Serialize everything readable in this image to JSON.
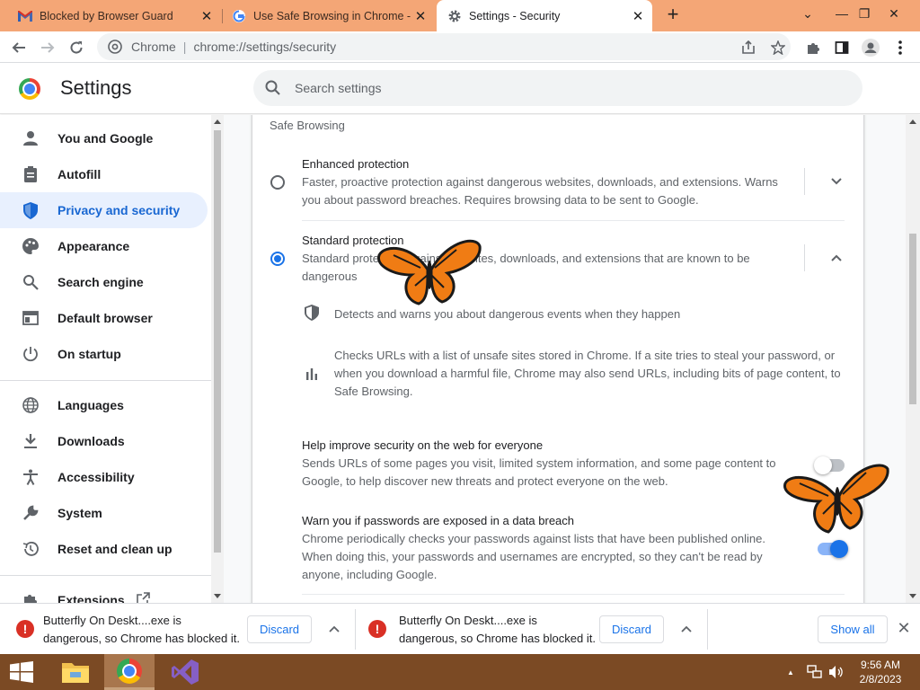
{
  "browser": {
    "tabs": [
      {
        "title": "Blocked by Browser Guard",
        "close": "✕",
        "icon": "gmail-icon"
      },
      {
        "title": "Use Safe Browsing in Chrome - C",
        "close": "✕",
        "icon": "google-icon"
      },
      {
        "title": "Settings - Security",
        "close": "✕",
        "icon": "gear-icon"
      }
    ],
    "new_tab": "+",
    "window_controls": {
      "menu": "⌄",
      "minimize": "—",
      "restore": "❐",
      "close": "✕"
    },
    "omnibox": {
      "site": "Chrome",
      "separator": "|",
      "url": "chrome://settings/security"
    }
  },
  "settings": {
    "title": "Settings",
    "search_placeholder": "Search settings",
    "sidebar": {
      "group1": [
        {
          "label": "You and Google",
          "icon": "person-icon"
        },
        {
          "label": "Autofill",
          "icon": "clipboard-icon"
        },
        {
          "label": "Privacy and security",
          "icon": "shield-icon",
          "active": true
        },
        {
          "label": "Appearance",
          "icon": "palette-icon"
        },
        {
          "label": "Search engine",
          "icon": "search-icon"
        },
        {
          "label": "Default browser",
          "icon": "browser-icon"
        },
        {
          "label": "On startup",
          "icon": "power-icon"
        }
      ],
      "group2": [
        {
          "label": "Languages",
          "icon": "globe-icon"
        },
        {
          "label": "Downloads",
          "icon": "download-icon"
        },
        {
          "label": "Accessibility",
          "icon": "accessibility-icon"
        },
        {
          "label": "System",
          "icon": "wrench-icon"
        },
        {
          "label": "Reset and clean up",
          "icon": "history-icon"
        }
      ],
      "extensions": "Extensions"
    },
    "safe_browsing": {
      "section_title": "Safe Browsing",
      "enhanced": {
        "title": "Enhanced protection",
        "desc_line1": "Faster, proactive protection against dangerous websites, downloads, and extensions. Warns",
        "desc_line2": "you about password breaches. Requires browsing data to be sent to Google.",
        "selected": false
      },
      "standard": {
        "title": "Standard protection",
        "desc_line1": "Standard protection against websites, downloads, and extensions that are known to be",
        "desc_line2": "dangerous",
        "selected": true,
        "bullet1": "Detects and warns you about dangerous events when they happen",
        "bullet2_line1": "Checks URLs with a list of unsafe sites stored in Chrome. If a site tries to steal your password, or",
        "bullet2_line2": "when you download a harmful file, Chrome may also send URLs, including bits of page content, to",
        "bullet2_line3": "Safe Browsing."
      },
      "help_improve": {
        "title": "Help improve security on the web for everyone",
        "desc_line1": "Sends URLs of some pages you visit, limited system information, and some page content to",
        "desc_line2": "Google, to help discover new threats and protect everyone on the web.",
        "enabled": false
      },
      "password_warn": {
        "title": "Warn you if passwords are exposed in a data breach",
        "desc_line1": "Chrome periodically checks your passwords against lists that have been published online.",
        "desc_line2": "When doing this, your passwords and usernames are encrypted, so they can't be read by",
        "desc_line3": "anyone, including Google.",
        "enabled": true
      }
    }
  },
  "downloads": {
    "items": [
      {
        "line1": "Butterfly On Deskt....exe is",
        "line2": "dangerous, so Chrome has blocked it.",
        "button": "Discard"
      },
      {
        "line1": "Butterfly On Deskt....exe is",
        "line2": "dangerous, so Chrome has blocked it.",
        "button": "Discard"
      }
    ],
    "show_all": "Show all",
    "close": "✕"
  },
  "taskbar": {
    "time": "9:56 AM",
    "date": "2/8/2023",
    "tray_arrow": "▲"
  },
  "colors": {
    "tabstrip": "#f4a676",
    "accent": "#1a73e8",
    "taskbar": "#7b4a24",
    "danger": "#d93025"
  }
}
